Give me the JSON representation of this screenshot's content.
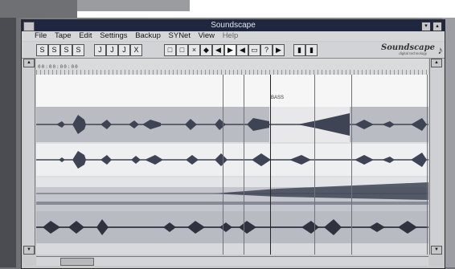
{
  "window": {
    "title": "Soundscape"
  },
  "menu": [
    "File",
    "Tape",
    "Edit",
    "Settings",
    "Backup",
    "SYNet",
    "View",
    "Help"
  ],
  "toolbar": {
    "left_groups": [
      "S",
      "S",
      "S",
      "S",
      "J",
      "J",
      "J",
      "X"
    ],
    "mid": [
      "□",
      "□",
      "×",
      "◆",
      "◀",
      "▶",
      "◀",
      "▭",
      "?",
      "▶",
      "▮",
      "▮"
    ]
  },
  "logo": {
    "name": "Soundscape",
    "sub": "digital technology",
    "icon": "music-note-icon"
  },
  "ruler": {
    "timecode": "00:00:00:00"
  },
  "track_label": "BASS",
  "colors": {
    "title_bg": "#1f2740",
    "wave": "#3e4453",
    "highlight": "#f4f4f6"
  }
}
